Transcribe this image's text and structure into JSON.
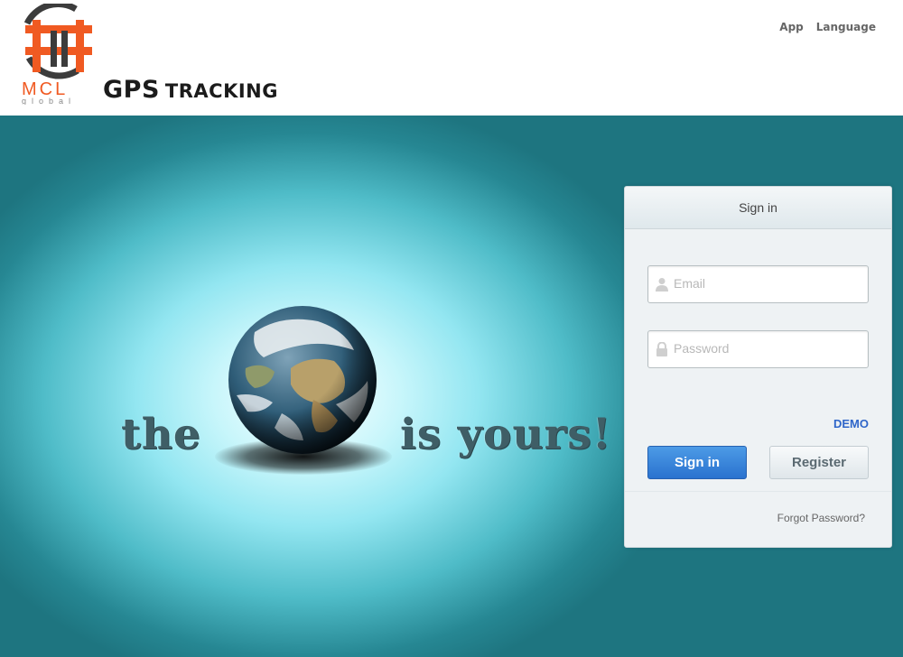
{
  "header": {
    "logo_text": "MCL",
    "logo_subtext": "global",
    "brand_primary": "GPS",
    "brand_secondary": "TRACKING",
    "nav": {
      "app": "App",
      "language": "Language"
    }
  },
  "hero": {
    "slogan_left": "the",
    "slogan_right": "is yours!"
  },
  "signin": {
    "title": "Sign in",
    "email_placeholder": "Email",
    "password_placeholder": "Password",
    "demo_link": "DEMO",
    "signin_button": "Sign in",
    "register_button": "Register",
    "forgot_link": "Forgot Password?"
  },
  "colors": {
    "logo_orange": "#f05a22",
    "logo_dark": "#444444",
    "primary_button": "#2f7fd9",
    "demo_link": "#2f66c9",
    "teal_background": "#268793"
  },
  "icons": {
    "email_field": "user-icon",
    "password_field": "lock-icon"
  }
}
